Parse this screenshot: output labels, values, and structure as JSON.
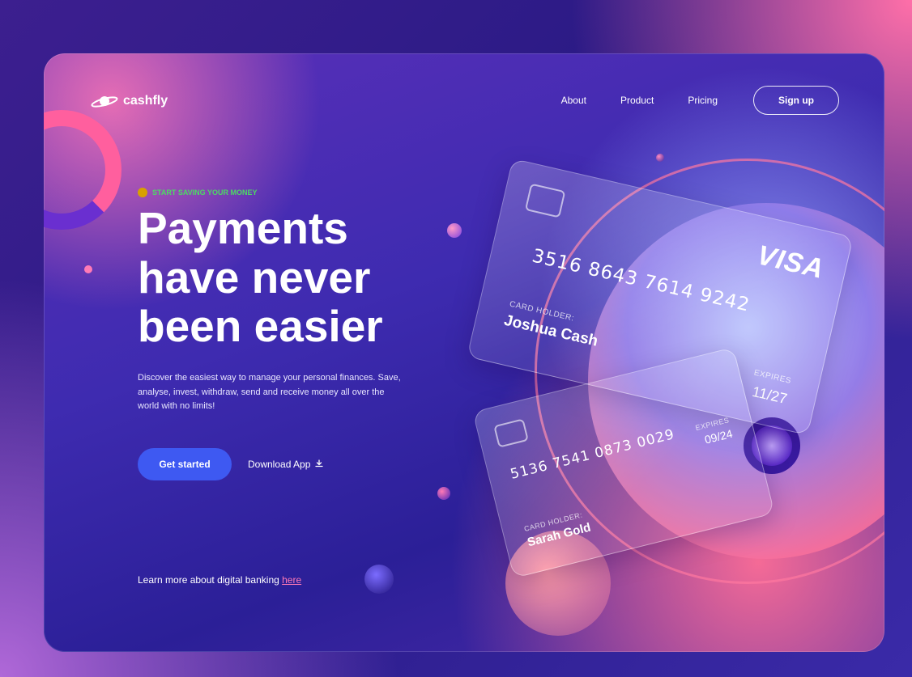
{
  "brand": {
    "name": "cashfly",
    "logo_icon": "planet-icon"
  },
  "nav": {
    "links": [
      "About",
      "Product",
      "Pricing"
    ],
    "signup_label": "Sign up"
  },
  "hero": {
    "eyebrow_icon": "money-bag-icon",
    "eyebrow": "START SAVING YOUR MONEY",
    "headline_lines": [
      "Payments",
      "have never",
      "been easier"
    ],
    "subtext": "Discover the easiest way to manage your personal finances. Save, analyse, invest, withdraw, send and receive money all over the world with no limits!",
    "cta_primary": "Get started",
    "cta_secondary": "Download App",
    "cta_secondary_icon": "download-icon"
  },
  "footer_note": {
    "text": "Learn more about digital banking ",
    "link": "here"
  },
  "cards": [
    {
      "number": "3516 8643 7614 9242",
      "holder_label": "CARD HOLDER:",
      "holder": "Joshua Cash",
      "expires_label": "EXPIRES",
      "expires": "11/27",
      "brand": "VISA"
    },
    {
      "number": "5136 7541 0873 0029",
      "holder_label": "CARD HOLDER:",
      "holder": "Sarah Gold",
      "expires_label": "EXPIRES",
      "expires": "09/24"
    }
  ],
  "colors": {
    "primary_button": "#3e59f2",
    "eyebrow_green": "#4cd964",
    "link_pink": "#ff7ab6"
  }
}
